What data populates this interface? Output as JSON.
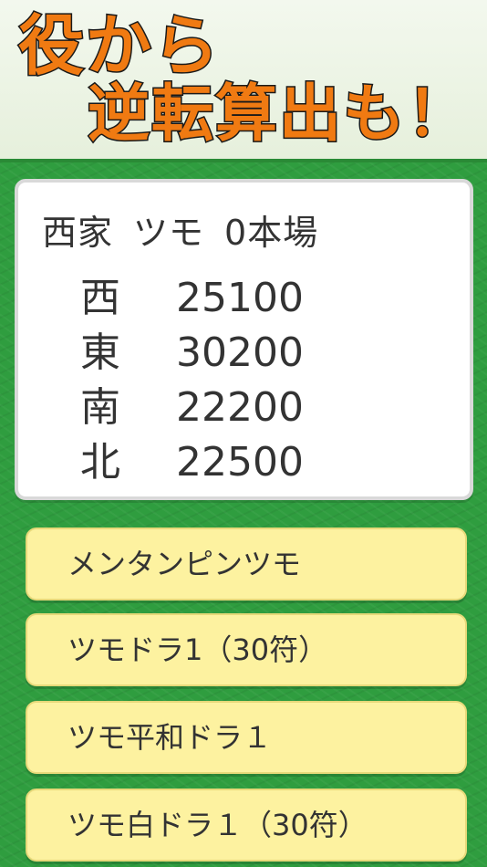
{
  "promo": {
    "line1": "役から",
    "line2": "逆転算出も！"
  },
  "situation": {
    "seat": "西家",
    "win_type": "ツモ",
    "honba": "0本場"
  },
  "scores": [
    {
      "wind": "西",
      "points": "25100"
    },
    {
      "wind": "東",
      "points": "30200"
    },
    {
      "wind": "南",
      "points": "22200"
    },
    {
      "wind": "北",
      "points": "22500"
    }
  ],
  "options": [
    "メンタンピンツモ",
    "ツモドラ1（30符）",
    "ツモ平和ドラ１",
    "ツモ白ドラ１（30符）"
  ],
  "colors": {
    "promo_text": "#f07a12",
    "field_green": "#2f9d3f",
    "option_bg": "#fdf2a0"
  }
}
